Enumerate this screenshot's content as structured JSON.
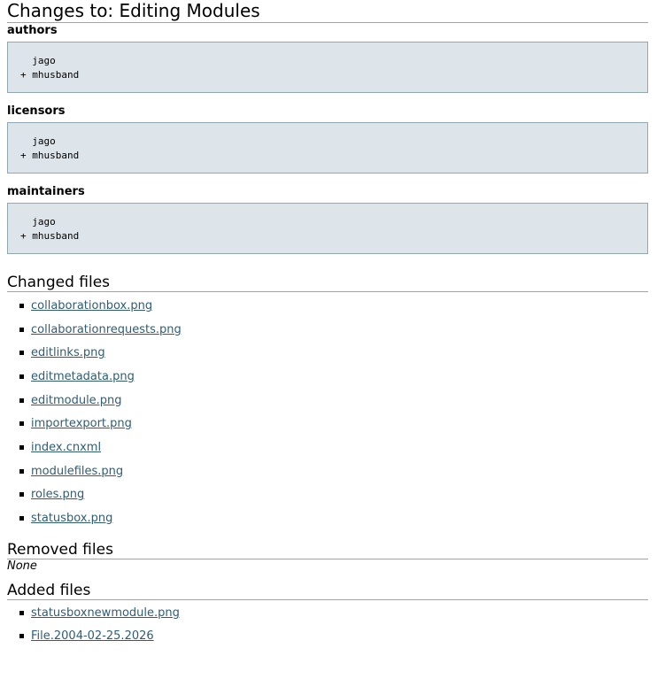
{
  "page": {
    "title": "Changes to: Editing Modules"
  },
  "metadata_sections": [
    {
      "heading": "authors",
      "diff": "  jago\n+ mhusband"
    },
    {
      "heading": "licensors",
      "diff": "  jago\n+ mhusband"
    },
    {
      "heading": "maintainers",
      "diff": "  jago\n+ mhusband"
    }
  ],
  "changed_files": {
    "heading": "Changed files",
    "items": [
      "collaborationbox.png",
      "collaborationrequests.png",
      "editlinks.png",
      "editmetadata.png",
      "editmodule.png",
      "importexport.png",
      "index.cnxml",
      "modulefiles.png",
      "roles.png",
      "statusbox.png"
    ]
  },
  "removed_files": {
    "heading": "Removed files",
    "empty_text": "None"
  },
  "added_files": {
    "heading": "Added files",
    "items": [
      "statusboxnewmodule.png",
      "File.2004-02-25.2026"
    ]
  },
  "colors": {
    "rule": "#8fa8b2",
    "diff_background": "#dde4ea",
    "link": "#2e5d75"
  }
}
